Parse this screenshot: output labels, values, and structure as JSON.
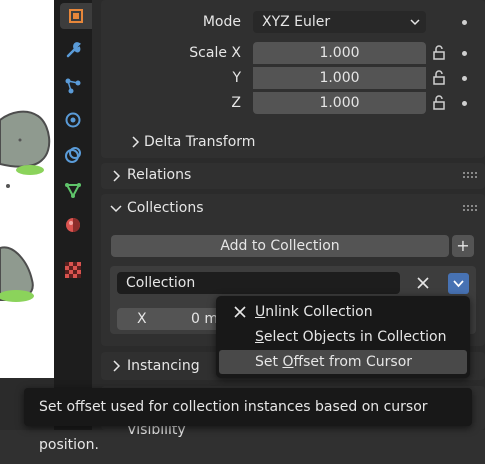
{
  "transform": {
    "mode_label": "Mode",
    "mode_value": "XYZ Euler",
    "scale_x_label": "Scale X",
    "scale_x_value": "1.000",
    "scale_y_label": "Y",
    "scale_y_value": "1.000",
    "scale_z_label": "Z",
    "scale_z_value": "1.000",
    "delta_transform_label": "Delta Transform"
  },
  "relations": {
    "label": "Relations"
  },
  "collections": {
    "label": "Collections",
    "add_button": "Add to Collection",
    "add_plus": "+",
    "collection_name": "Collection",
    "offset_x_label": "X",
    "offset_x_value": "0 m"
  },
  "instancing": {
    "label": "Instancing"
  },
  "visibility": {
    "label": "Visibility"
  },
  "context_menu": {
    "items": [
      {
        "pre": "",
        "u": "U",
        "post": "nlink Collection"
      },
      {
        "pre": "",
        "u": "S",
        "post": "elect Objects in Collection"
      },
      {
        "pre": "Set ",
        "u": "O",
        "post": "ffset from Cursor"
      }
    ]
  },
  "tooltip": {
    "text": "Set offset used for collection instances based on cursor position."
  },
  "colors": {
    "accent_blue": "#4772b3",
    "panel_bg": "#303030",
    "field_bg": "#545454",
    "menu_bg": "#181818",
    "menu_highlight": "#494949"
  },
  "icons": [
    "object-icon",
    "wrench-icon",
    "particles-icon",
    "physics-icon",
    "constraints-icon",
    "data-icon",
    "material-icon",
    "texture-icon"
  ]
}
